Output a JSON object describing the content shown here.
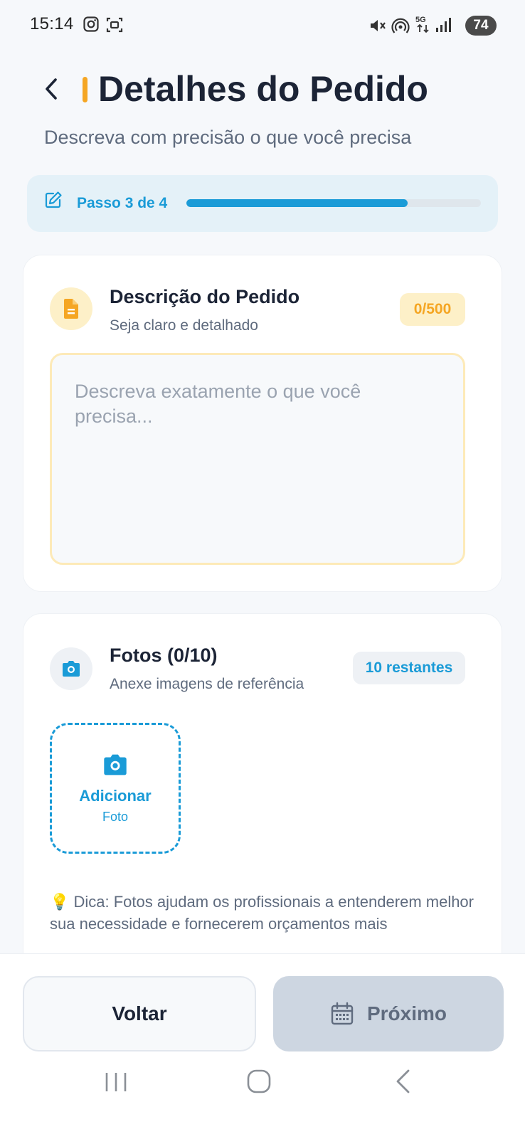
{
  "status_bar": {
    "time": "15:14",
    "battery": "74",
    "icons": [
      "instagram-icon",
      "screen-record-icon",
      "mute-icon",
      "hotspot-icon",
      "5g-icon",
      "signal-icon"
    ]
  },
  "header": {
    "title": "Detalhes do Pedido",
    "subtitle": "Descreva com precisão o que você precisa",
    "accent_color": "#f5a623"
  },
  "progress": {
    "label": "Passo 3 de 4",
    "value": 0.75,
    "color": "#1a9bd7"
  },
  "description_card": {
    "title": "Descrição do Pedido",
    "subtitle": "Seja claro e detalhado",
    "counter": "0/500",
    "textarea_value": "",
    "placeholder": "Descreva exatamente o que você precisa..."
  },
  "photos_card": {
    "title": "Fotos (0/10)",
    "subtitle": "Anexe imagens de referência",
    "badge": "10 restantes",
    "add_label_line1": "Adicionar",
    "add_label_line2": "Foto",
    "tip": "💡 Dica: Fotos ajudam os profissionais a entenderem melhor sua necessidade e fornecerem orçamentos mais"
  },
  "footer": {
    "back_label": "Voltar",
    "next_label": "Próximo"
  },
  "system_nav": [
    "recent-apps-icon",
    "home-icon",
    "back-nav-icon"
  ]
}
